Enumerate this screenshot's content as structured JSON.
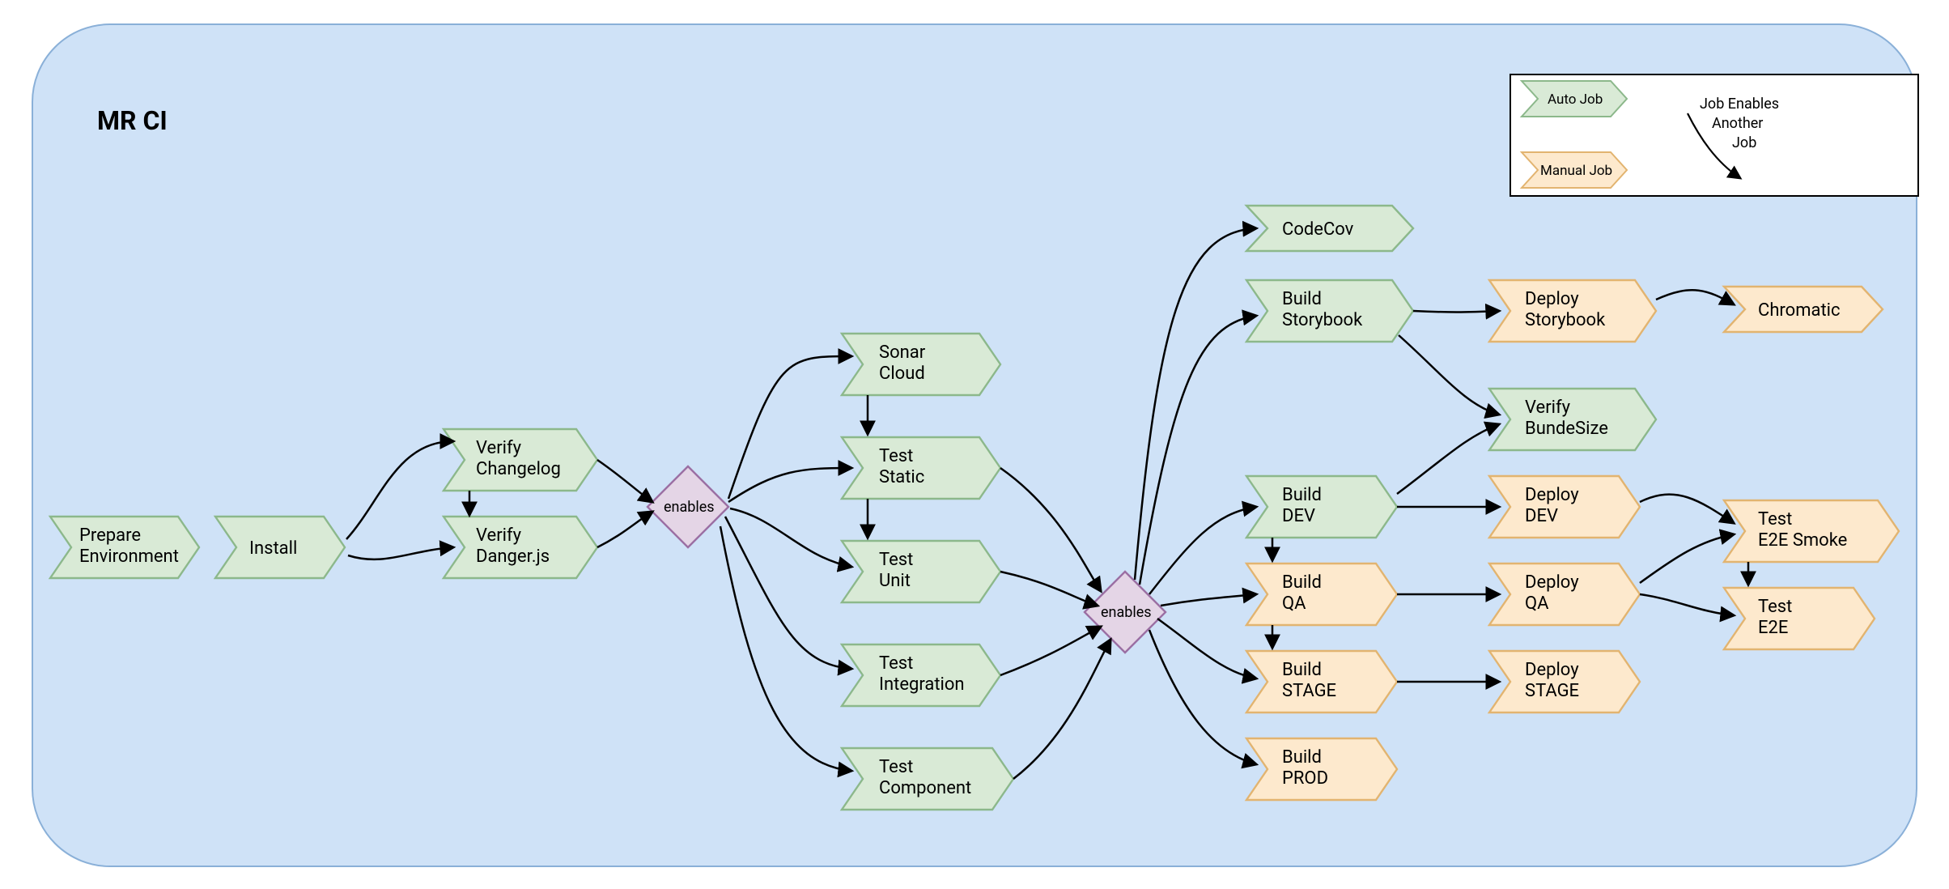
{
  "title": "MR CI",
  "colors": {
    "canvas_bg": "#cfe2f7",
    "auto_fill": "#d9ead6",
    "auto_stroke": "#8cb88b",
    "manual_fill": "#fde9cd",
    "manual_stroke": "#e2b470",
    "diamond_fill": "#e4d5e6",
    "diamond_stroke": "#9b6fa3",
    "arrow": "#000000"
  },
  "legend": {
    "auto": "Auto Job",
    "manual": "Manual Job",
    "enables_line1": "Job Enables",
    "enables_line2": "Another",
    "enables_line3": "Job"
  },
  "diamonds": {
    "d1": "enables",
    "d2": "enables"
  },
  "nodes": {
    "prepare": {
      "type": "auto",
      "lines": [
        "Prepare",
        "Environment"
      ]
    },
    "install": {
      "type": "auto",
      "lines": [
        "Install"
      ]
    },
    "verify_changelog": {
      "type": "auto",
      "lines": [
        "Verify",
        "Changelog"
      ]
    },
    "verify_danger": {
      "type": "auto",
      "lines": [
        "Verify",
        "Danger.js"
      ]
    },
    "sonar": {
      "type": "auto",
      "lines": [
        "Sonar",
        "Cloud"
      ]
    },
    "test_static": {
      "type": "auto",
      "lines": [
        "Test",
        "Static"
      ]
    },
    "test_unit": {
      "type": "auto",
      "lines": [
        "Test",
        "Unit"
      ]
    },
    "test_integration": {
      "type": "auto",
      "lines": [
        "Test",
        "Integration"
      ]
    },
    "test_component": {
      "type": "auto",
      "lines": [
        "Test",
        "Component"
      ]
    },
    "codecov": {
      "type": "auto",
      "lines": [
        "CodeCov"
      ]
    },
    "build_storybook": {
      "type": "auto",
      "lines": [
        "Build",
        "Storybook"
      ]
    },
    "build_dev": {
      "type": "auto",
      "lines": [
        "Build",
        "DEV"
      ]
    },
    "build_qa": {
      "type": "manual",
      "lines": [
        "Build",
        "QA"
      ]
    },
    "build_stage": {
      "type": "manual",
      "lines": [
        "Build",
        "STAGE"
      ]
    },
    "build_prod": {
      "type": "manual",
      "lines": [
        "Build",
        "PROD"
      ]
    },
    "deploy_storybook": {
      "type": "manual",
      "lines": [
        "Deploy",
        "Storybook"
      ]
    },
    "verify_bundle": {
      "type": "auto",
      "lines": [
        "Verify",
        "BundeSize"
      ]
    },
    "deploy_dev": {
      "type": "manual",
      "lines": [
        "Deploy",
        "DEV"
      ]
    },
    "deploy_qa": {
      "type": "manual",
      "lines": [
        "Deploy",
        "QA"
      ]
    },
    "deploy_stage": {
      "type": "manual",
      "lines": [
        "Deploy",
        "STAGE"
      ]
    },
    "chromatic": {
      "type": "manual",
      "lines": [
        "Chromatic"
      ]
    },
    "test_e2e_smoke": {
      "type": "manual",
      "lines": [
        "Test",
        "E2E Smoke"
      ]
    },
    "test_e2e": {
      "type": "manual",
      "lines": [
        "Test",
        "E2E"
      ]
    }
  }
}
